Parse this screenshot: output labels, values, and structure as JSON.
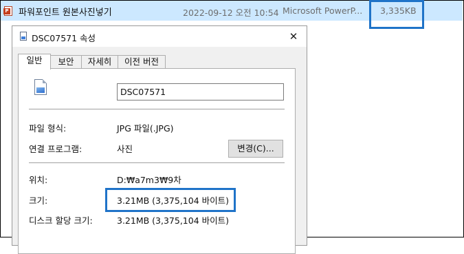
{
  "explorer_row": {
    "name": "파워포인트 원본사진넣기",
    "modified": "2022-09-12 오전 10:54",
    "type": "Microsoft PowerP...",
    "size": "3,335KB",
    "icon": "powerpoint-file-icon"
  },
  "dialog": {
    "title": "DSC07571 속성",
    "close_glyph": "✕",
    "tabs": [
      {
        "label": "일반",
        "active": true
      },
      {
        "label": "보안",
        "active": false
      },
      {
        "label": "자세히",
        "active": false
      },
      {
        "label": "이전 버전",
        "active": false
      }
    ],
    "general": {
      "file_name": "DSC07571",
      "file_type_label": "파일 형식:",
      "file_type_value": "JPG 파일(.JPG)",
      "open_with_label": "연결 프로그램:",
      "open_with_value": "사진",
      "change_button": "변경(C)...",
      "location_label": "위치:",
      "location_value": "D:₩a7m3₩9차",
      "size_label": "크기:",
      "size_value": "3.21MB (3,375,104 바이트)",
      "size_on_disk_label": "디스크 할당 크기:",
      "size_on_disk_value": "3.21MB (3,375,104 바이트)"
    }
  },
  "colors": {
    "selection": "#cce8ff",
    "highlight_box": "#1f73c8"
  }
}
